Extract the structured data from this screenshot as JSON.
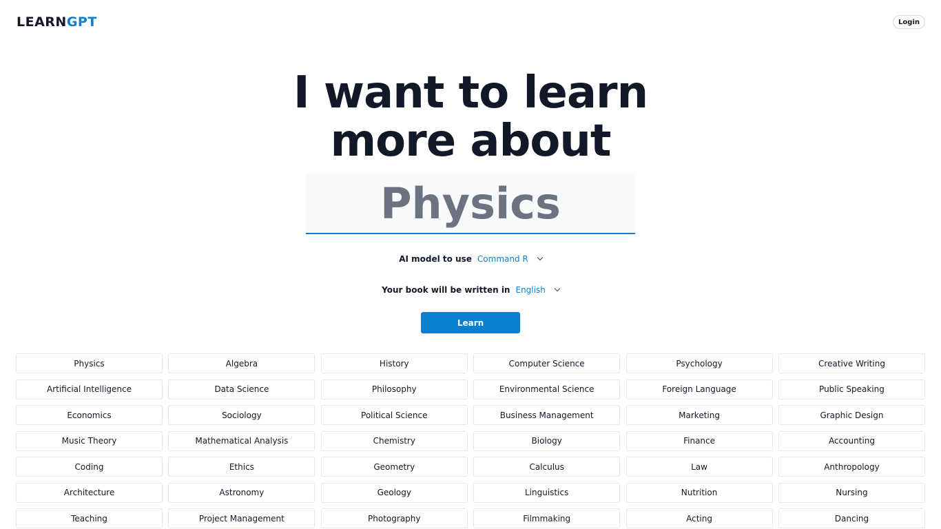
{
  "header": {
    "logo_part1": "LEARN",
    "logo_part2": "GPT",
    "login_label": "Login"
  },
  "hero": {
    "line1": "I want to learn",
    "line2": "more about",
    "topic_value": "Physics"
  },
  "model_select": {
    "label": "AI model to use",
    "value": "Command R"
  },
  "language_select": {
    "label": "Your book will be written in",
    "value": "English"
  },
  "learn_button": "Learn",
  "topics": [
    "Physics",
    "Algebra",
    "History",
    "Computer Science",
    "Psychology",
    "Creative Writing",
    "Artificial Intelligence",
    "Data Science",
    "Philosophy",
    "Environmental Science",
    "Foreign Language",
    "Public Speaking",
    "Economics",
    "Sociology",
    "Political Science",
    "Business Management",
    "Marketing",
    "Graphic Design",
    "Music Theory",
    "Mathematical Analysis",
    "Chemistry",
    "Biology",
    "Finance",
    "Accounting",
    "Coding",
    "Ethics",
    "Geometry",
    "Calculus",
    "Law",
    "Anthropology",
    "Architecture",
    "Astronomy",
    "Geology",
    "Linguistics",
    "Nutrition",
    "Nursing",
    "Teaching",
    "Project Management",
    "Photography",
    "Filmmaking",
    "Acting",
    "Dancing"
  ],
  "colors": {
    "accent": "#0b7fd0",
    "text": "#111827",
    "muted": "#6b7280"
  }
}
